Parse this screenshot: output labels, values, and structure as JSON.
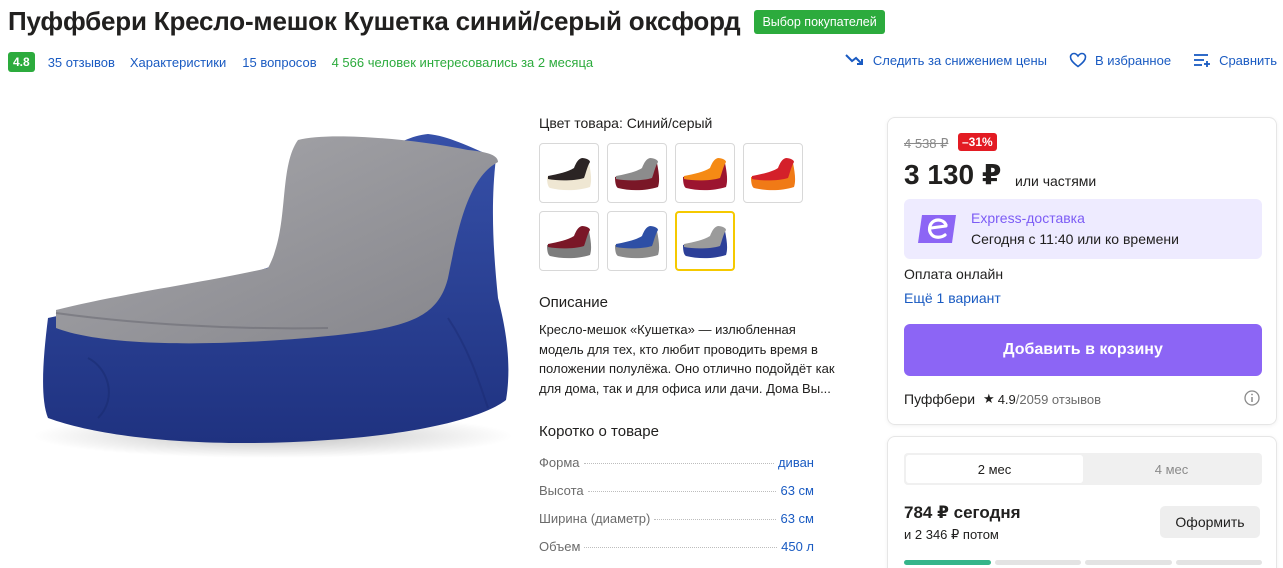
{
  "header": {
    "title": "Пуффбери Кресло-мешок Кушетка синий/серый оксфорд",
    "badge": "Выбор покупателей"
  },
  "meta": {
    "rating": "4.8",
    "reviews": "35 отзывов",
    "characteristics": "Характеристики",
    "questions": "15 вопросов",
    "interest": "4 566 человек интересовались за 2 месяца"
  },
  "actions": {
    "track_price": "Следить за снижением цены",
    "favorite": "В избранное",
    "compare": "Сравнить"
  },
  "color": {
    "label": "Цвет товара:",
    "value": "Синий/серый",
    "swatches": [
      {
        "name": "black-beige",
        "top": "#2b2424",
        "bottom": "#efe7d3"
      },
      {
        "name": "grey-burgundy",
        "top": "#8c8c8c",
        "bottom": "#7a1727"
      },
      {
        "name": "orange-burgundy",
        "top": "#f58a14",
        "bottom": "#9c1530"
      },
      {
        "name": "red-orange",
        "top": "#d4202a",
        "bottom": "#f07a16"
      },
      {
        "name": "burgundy-grey",
        "top": "#7a1727",
        "bottom": "#7d7d7d"
      },
      {
        "name": "blue-grey",
        "top": "#2e4fa5",
        "bottom": "#8a8a8a"
      },
      {
        "name": "grey-blue",
        "top": "#9b9b9b",
        "bottom": "#2c3f98"
      }
    ],
    "selected_index": 6
  },
  "description": {
    "title": "Описание",
    "text": "Кресло-мешок «Кушетка» — излюбленная модель для тех, кто любит проводить время в положении полулёжа. Оно отлично подойдёт как для дома, так и для офиса или дачи. Дома Вы..."
  },
  "short_info": {
    "title": "Коротко о товаре",
    "specs": [
      {
        "name": "Форма",
        "value": "диван"
      },
      {
        "name": "Высота",
        "value": "63 см"
      },
      {
        "name": "Ширина (диаметр)",
        "value": "63 см"
      },
      {
        "name": "Объем",
        "value": "450 л"
      }
    ]
  },
  "buy": {
    "old_price": "4 538 ₽",
    "discount": "–31%",
    "price": "3 130 ₽",
    "parts": "или частями",
    "express_title": "Express-доставка",
    "express_sub": "Сегодня с 11:40 или ко времени",
    "payment": "Оплата онлайн",
    "more_variant": "Ещё 1 вариант",
    "add_to_cart": "Добавить в корзину",
    "seller": "Пуффбери",
    "seller_rating": "4.9",
    "seller_reviews": "/2059 отзывов"
  },
  "installment": {
    "tabs": [
      "2 мес",
      "4 мес"
    ],
    "active_tab": 0,
    "today": "784 ₽ сегодня",
    "later": "и 2 346 ₽ потом",
    "checkout": "Оформить",
    "segments_done": 1,
    "segments_total": 4
  },
  "colors": {
    "accent_green": "#2cab3d",
    "link_blue": "#1a5bc2",
    "cart_purple": "#8c65f5",
    "discount_red": "#e31b23",
    "selected_swatch": "#f5c900"
  }
}
